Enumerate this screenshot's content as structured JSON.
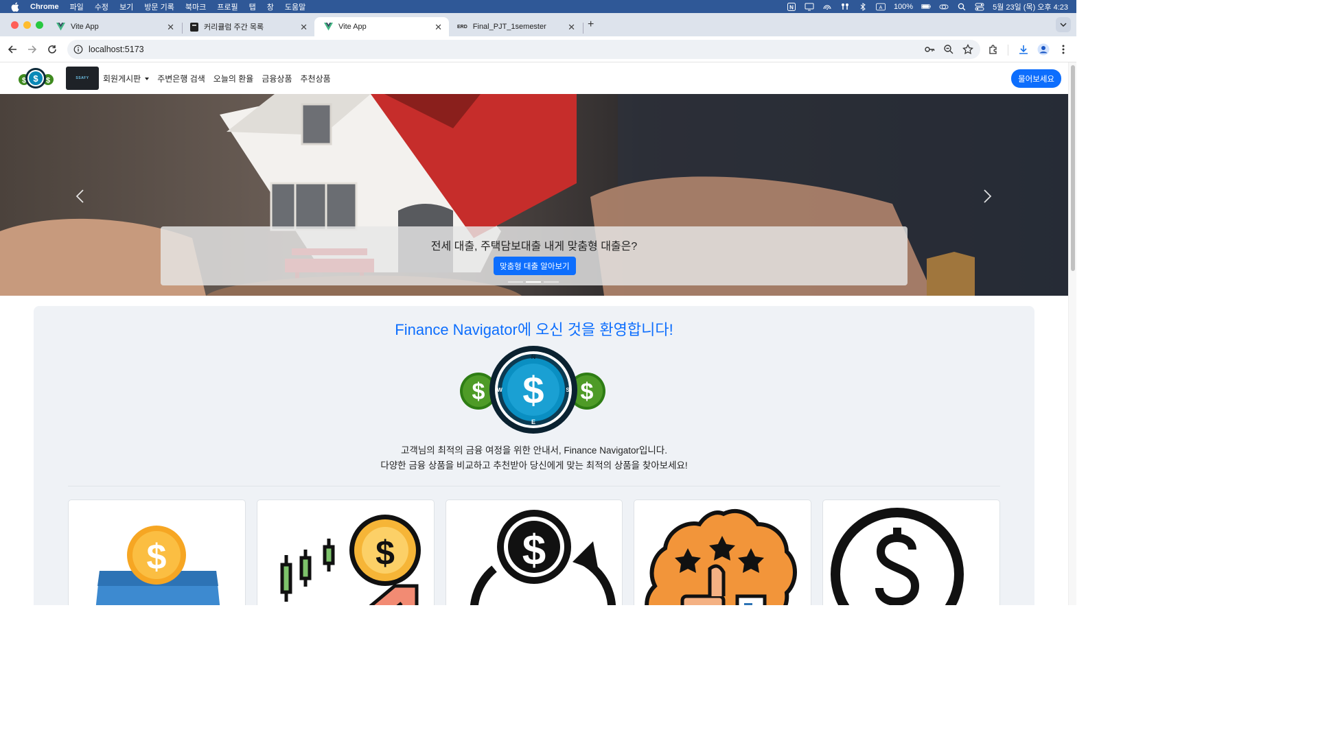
{
  "menubar": {
    "app": "Chrome",
    "items": [
      "파일",
      "수정",
      "보기",
      "방문 기록",
      "북마크",
      "프로필",
      "탭",
      "창",
      "도움말"
    ],
    "battery": "100%",
    "datetime": "5월 23일 (목) 오후 4:23"
  },
  "tabs": [
    {
      "title": "Vite App",
      "favicon": "vue-icon"
    },
    {
      "title": "커리큘럼 주간 목록",
      "favicon": "doc-icon"
    },
    {
      "title": "Vite App",
      "favicon": "vue-icon"
    },
    {
      "title": "Final_PJT_1semester",
      "favicon": "erd-icon",
      "prefix": "ERD"
    }
  ],
  "address": {
    "url": "localhost:5173"
  },
  "site": {
    "brand_badge": "SSAFY",
    "nav": [
      "회원게시판",
      "주변은행 검색",
      "오늘의 환율",
      "금융상품",
      "추천상품"
    ],
    "ask_button": "물어보세요"
  },
  "carousel": {
    "caption": "전세 대출, 주택담보대출 내게 맞춤형 대출은?",
    "cta": "맞춤형 대출 알아보기",
    "slides": 3,
    "active_slide": 2
  },
  "welcome": {
    "title": "Finance Navigator에 오신 것을 환영합니다!",
    "line1": "고객님의 최적의 금융 여정을 위한 안내서, Finance Navigator입니다.",
    "line2": "다양한 금융 상품을 비교하고 추천받아 당신에게 맞는 최적의 상품을 찾아보세요!",
    "compass_letters": [
      "N",
      "E",
      "W",
      "S"
    ]
  },
  "cards": [
    {
      "icon": "deposit-coin-icon"
    },
    {
      "icon": "investment-growth-icon"
    },
    {
      "icon": "currency-exchange-icon"
    },
    {
      "icon": "recommend-thumb-icon"
    },
    {
      "icon": "dollar-coin-icon"
    }
  ],
  "colors": {
    "primary": "#0d6efd",
    "menubar": "#2f5897",
    "welcome_bg": "#eff2f6"
  }
}
